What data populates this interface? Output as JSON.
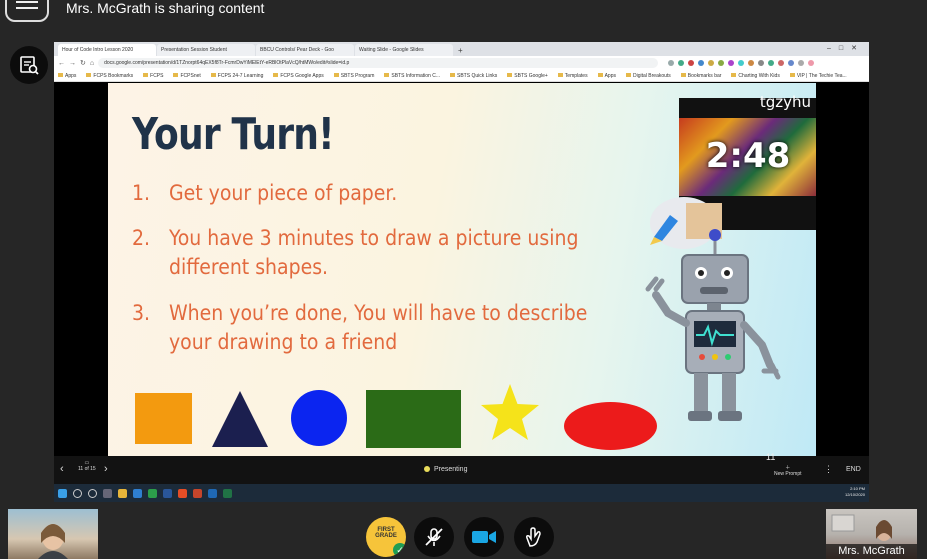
{
  "header": {
    "title": "Mrs. McGrath is sharing content"
  },
  "browser": {
    "tabs": [
      {
        "label": "Hour of Code Intro Lesson 2020",
        "active": true
      },
      {
        "label": "Presentation Session Student",
        "active": false
      },
      {
        "label": "BBCU Controls/ Pear Deck - Goo",
        "active": false
      },
      {
        "label": "Waiting Slide - Google Slides",
        "active": false
      }
    ],
    "new_tab": "+",
    "url": "docs.google.com/presentation/d/1TZnorpt64qEX5f8Tr-FcmrDwYiMElEtY-eRBlOtPlaVcQ/htMWo/edit#slide=id.p",
    "bookmarks": [
      "Apps",
      "FCPS Bookmarks",
      "FCPS",
      "FCPSnet",
      "FCPS 24-7 Learning",
      "FCPS Google Apps",
      "SBTS Program",
      "SBTS Information C...",
      "SBTS Quick Links",
      "SBTS Google+",
      "Templates",
      "Apps",
      "Digital Breakouts",
      "Bookmarks bar",
      "Charting With Kids",
      "VIP | The Techie Tea..."
    ]
  },
  "slide": {
    "title": "Your Turn!",
    "steps": [
      {
        "num": "1.",
        "text": "Get your  piece of paper."
      },
      {
        "num": "2.",
        "text": "You have 3 minutes to draw a picture using different shapes."
      },
      {
        "num": "3.",
        "text": "When you’re done, You will have to describe your drawing to a friend"
      }
    ],
    "timer_value": "2:48",
    "timer_code": "tgzyhu"
  },
  "presenter_bar": {
    "prev": "‹",
    "counter": "11 of 15",
    "next": "›",
    "status": "Presenting",
    "slide_number": "11",
    "new_prompt": "New Prompt",
    "more": "⋮",
    "end": "END"
  },
  "taskbar": {
    "time": "2:10 PM",
    "date": "12/10/2020"
  },
  "participants": {
    "presenter_name": "Mrs. McGrath",
    "avatar_caption": "FIRST GRADE"
  },
  "colors": {
    "title": "#203349",
    "steps": "#e26a3e",
    "square": "#f39a0f",
    "triangle": "#1b1f4f",
    "circle": "#0b25f0",
    "rectangle": "#2b6b17",
    "star": "#f5e31a",
    "oval": "#ec1b1b"
  }
}
